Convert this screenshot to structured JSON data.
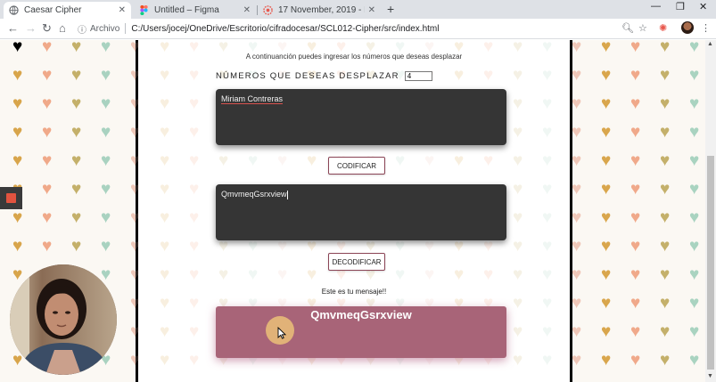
{
  "browser": {
    "tabs": [
      {
        "title": "Caesar Cipher",
        "icon": "globe-icon",
        "active": true
      },
      {
        "title": "Untitled – Figma",
        "icon": "figma-icon",
        "active": false
      },
      {
        "title": "17 November, 2019 - Loom Reco",
        "icon": "loom-icon",
        "active": false
      }
    ],
    "new_tab": "+",
    "address": {
      "scheme_label": "Archivo",
      "path": "C:/Users/jocej/OneDrive/Escritorio/cifradocesar/SCL012-Cipher/src/index.html"
    }
  },
  "page": {
    "intro": "A continuanción puedes ingresar los números que deseas desplazar",
    "shift_label": "NÚMEROS QUE DESEAS DESPLAZAR",
    "shift_value": "4",
    "input_text": "Miriam Contreras",
    "encode_button": "CODIFICAR",
    "encoded_text": "QmvmeqGsrxview",
    "decode_button": "DECODIFICAR",
    "result_label": "Este es tu mensaje!!",
    "result_text": "QmvmeqGsrxview"
  },
  "colors": {
    "textbox_bg": "#353535",
    "result_bg": "#a86478",
    "button_border": "#8b4556",
    "heart_palette": [
      "#f0a98a",
      "#c4b06a",
      "#a9d3c0",
      "#efc7b8",
      "#d9a64c"
    ]
  }
}
